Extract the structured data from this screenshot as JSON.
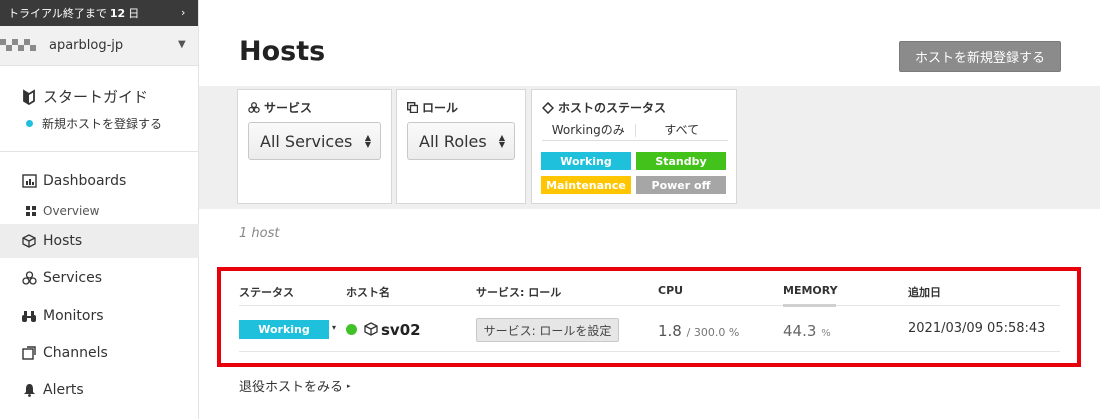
{
  "trial": {
    "prefix": "トライアル終了まで",
    "days": "12",
    "suffix": "日",
    "chevron": "›"
  },
  "org": {
    "name": "aparblog-jp",
    "caret": "▼"
  },
  "guide": {
    "title": "スタートガイド",
    "sub": "新規ホストを登録する"
  },
  "nav": {
    "dashboards": "Dashboards",
    "overview": "Overview",
    "hosts": "Hosts",
    "services": "Services",
    "monitors": "Monitors",
    "channels": "Channels",
    "alerts": "Alerts"
  },
  "page": {
    "title": "Hosts",
    "new_host_button": "ホストを新規登録する",
    "host_count": "1 host",
    "retired_link": "退役ホストをみる",
    "retired_arrow": "▸"
  },
  "filters": {
    "service_label": "サービス",
    "service_value": "All Services",
    "role_label": "ロール",
    "role_value": "All Roles",
    "status_label": "ホストのステータス",
    "toggle_working_only": "Workingのみ",
    "toggle_all": "すべて",
    "chips": [
      {
        "label": "Working",
        "color": "#1ec0dc"
      },
      {
        "label": "Standby",
        "color": "#44c21c"
      },
      {
        "label": "Maintenance",
        "color": "#ffc600"
      },
      {
        "label": "Power off",
        "color": "#a6a6a6"
      }
    ]
  },
  "table": {
    "headers": {
      "status": "ステータス",
      "hostname": "ホスト名",
      "service_role": "サービス: ロール",
      "cpu": "CPU",
      "memory": "MEMORY",
      "added": "追加日"
    },
    "row": {
      "status": "Working",
      "status_color": "#1ec0dc",
      "status_caret": "▾",
      "hostname": "sv02",
      "service_role_button": "サービス: ロールを設定",
      "cpu_value": "1.8",
      "cpu_max": "/ 300.0 %",
      "memory_value": "44.3",
      "memory_unit": "%",
      "added": "2021/03/09 05:58:43"
    }
  },
  "colors": {
    "highlight_frame": "#e8000b",
    "online_dot": "#41c22a"
  }
}
